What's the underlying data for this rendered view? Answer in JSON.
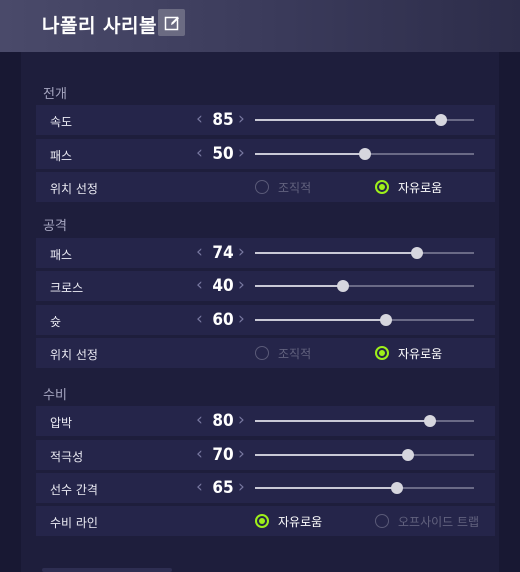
{
  "header": {
    "title": "나폴리 사리볼",
    "edit_icon": "edit-icon"
  },
  "sections": [
    {
      "title": "전개",
      "rows": [
        {
          "label": "속도",
          "type": "slider",
          "value": "85"
        },
        {
          "label": "패스",
          "type": "slider",
          "value": "50"
        },
        {
          "label": "위치 선정",
          "type": "radio",
          "options": [
            "조직적",
            "자유로움"
          ],
          "selected": "자유로움"
        }
      ]
    },
    {
      "title": "공격",
      "rows": [
        {
          "label": "패스",
          "type": "slider",
          "value": "74"
        },
        {
          "label": "크로스",
          "type": "slider",
          "value": "40"
        },
        {
          "label": "슛",
          "type": "slider",
          "value": "60"
        },
        {
          "label": "위치 선정",
          "type": "radio",
          "options": [
            "조직적",
            "자유로움"
          ],
          "selected": "자유로움"
        }
      ]
    },
    {
      "title": "수비",
      "rows": [
        {
          "label": "압박",
          "type": "slider",
          "value": "80"
        },
        {
          "label": "적극성",
          "type": "slider",
          "value": "70"
        },
        {
          "label": "선수 간격",
          "type": "slider",
          "value": "65"
        },
        {
          "label": "수비 라인",
          "type": "radio",
          "options": [
            "자유로움",
            "오프사이드 트랩"
          ],
          "selected": "자유로움"
        }
      ]
    }
  ],
  "colors": {
    "accent": "#9ef01a",
    "row_bg": "#25254a",
    "panel_bg": "#1e1e3c"
  }
}
